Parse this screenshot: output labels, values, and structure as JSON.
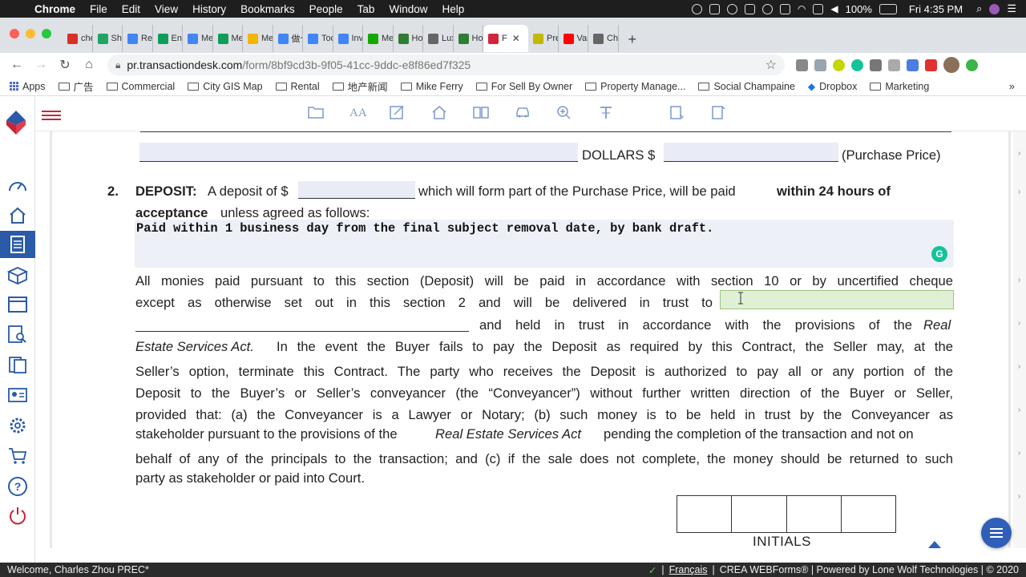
{
  "mac_menubar": {
    "app_name": "Chrome",
    "menus": [
      "File",
      "Edit",
      "View",
      "History",
      "Bookmarks",
      "People",
      "Tab",
      "Window",
      "Help"
    ],
    "battery": "100%",
    "clock": "Fri 4:35 PM"
  },
  "tabs": [
    {
      "label": "chec",
      "icon_color": "#d93025",
      "icon_name": "gmail-icon"
    },
    {
      "label": "Shar",
      "icon_color": "#1fa463",
      "icon_name": "drive-icon"
    },
    {
      "label": "Real",
      "icon_color": "#4285f4",
      "icon_name": "docs-icon"
    },
    {
      "label": "Engl",
      "icon_color": "#0f9d58",
      "icon_name": "sheets-icon"
    },
    {
      "label": "Ment",
      "icon_color": "#4285f4",
      "icon_name": "docs-icon"
    },
    {
      "label": "Ment",
      "icon_color": "#0f9d58",
      "icon_name": "sheets-icon"
    },
    {
      "label": "Ment",
      "icon_color": "#f4b400",
      "icon_name": "slides-icon"
    },
    {
      "label": "做个",
      "icon_color": "#4285f4",
      "icon_name": "docs-icon"
    },
    {
      "label": "Todo",
      "icon_color": "#4285f4",
      "icon_name": "docs-icon"
    },
    {
      "label": "Inves",
      "icon_color": "#4285f4",
      "icon_name": "docs-icon"
    },
    {
      "label": "Mes",
      "icon_color": "#14a800",
      "icon_name": "upwork-icon"
    },
    {
      "label": "Hom",
      "icon_color": "#2e7d32",
      "icon_name": "realtor-icon"
    },
    {
      "label": "Luxn",
      "icon_color": "#666666",
      "icon_name": "luxury-icon"
    },
    {
      "label": "Hom",
      "icon_color": "#2e7d32",
      "icon_name": "realtor-icon"
    },
    {
      "label": "F",
      "icon_color": "#d0263c",
      "icon_name": "transactiondesk-icon",
      "active": true
    },
    {
      "label": "Prep",
      "icon_color": "#c4b800",
      "icon_name": "download-icon"
    },
    {
      "label": "Vanc",
      "icon_color": "#ff0000",
      "icon_name": "youtube-icon"
    },
    {
      "label": "Char",
      "icon_color": "#666666",
      "icon_name": "globe-icon"
    }
  ],
  "omnibox": {
    "host": "pr.transactiondesk.com",
    "path": "/form/8bf9cd3b-9f05-41cc-9ddc-e8f86ed7f325"
  },
  "bookmarks": [
    {
      "label": "Apps",
      "icon": "apps-grid-icon"
    },
    {
      "label": "广告",
      "icon": "folder-icon"
    },
    {
      "label": "Commercial",
      "icon": "folder-icon"
    },
    {
      "label": "City GIS Map",
      "icon": "folder-icon"
    },
    {
      "label": "Rental",
      "icon": "folder-icon"
    },
    {
      "label": "地产新闻",
      "icon": "folder-icon"
    },
    {
      "label": "Mike Ferry",
      "icon": "folder-icon"
    },
    {
      "label": "For Sell By Owner",
      "icon": "folder-icon"
    },
    {
      "label": "Property Manage...",
      "icon": "folder-icon"
    },
    {
      "label": "Social Champaine",
      "icon": "folder-icon"
    },
    {
      "label": "Dropbox",
      "icon": "dropbox-icon"
    },
    {
      "label": "Marketing",
      "icon": "folder-icon"
    }
  ],
  "bookmarks_more": "»",
  "document": {
    "dollars_label": "DOLLARS $",
    "purchase_price_label": "(Purchase Price)",
    "section_number": "2.",
    "deposit_heading": "DEPOSIT:",
    "deposit_text_a": "A deposit of $",
    "deposit_text_b": "which will form part of the Purchase Price, will be paid",
    "deposit_bold_a": "within 24 hours of",
    "deposit_bold_b": "acceptance",
    "deposit_text_c": "unless agreed as follows:",
    "deposit_terms_value": "Paid within 1 business day from the final subject removal date, by bank draft.",
    "para_line1": "All monies paid pursuant to this section (Deposit) will be paid in accordance with section 10 or by uncertified cheque",
    "para_line2": "except as otherwise set out in this section 2 and will be delivered in trust to",
    "para_line3_a": "and held in trust in accordance with the provisions of the",
    "para_line3_b": "Real",
    "para_line4_a": "Estate Services Act.",
    "para_line4_b": "In the event the Buyer fails to pay the Deposit as required by this Contract, the Seller may, at the",
    "para_line5": "Seller’s option, terminate this Contract. The party who receives the Deposit is authorized to pay all or any portion of the",
    "para_line6": "Deposit to the Buyer’s or Seller’s conveyancer (the “Conveyancer”) without further written direction of the Buyer or Seller,",
    "para_line7": "provided that: (a) the Conveyancer is a Lawyer or Notary; (b) such money is to be held in trust by the Conveyancer as",
    "para_line8_a": "stakeholder pursuant to the provisions of the",
    "para_line8_b": "Real Estate Services Act",
    "para_line8_c": "pending the completion of the transaction and not on",
    "para_line9": "behalf of any of the principals to the transaction; and (c) if the sale does not complete, the money should be returned to such",
    "para_line10": "party as stakeholder or paid into Court.",
    "initials_label": "INITIALS"
  },
  "statusbar": {
    "welcome": "Welcome, Charles Zhou PREC*",
    "separator": "|",
    "language_link": "Français",
    "footer": "CREA WEBForms® | Powered by Lone Wolf Technologies | © 2020"
  }
}
